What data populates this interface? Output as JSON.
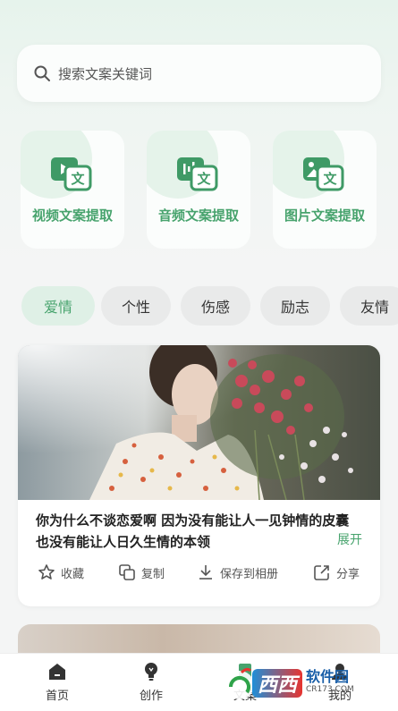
{
  "search": {
    "placeholder": "搜索文案关键词"
  },
  "tools": [
    {
      "label": "视频文案提取",
      "icon": "video-to-text-icon"
    },
    {
      "label": "音频文案提取",
      "icon": "audio-to-text-icon"
    },
    {
      "label": "图片文案提取",
      "icon": "image-to-text-icon"
    }
  ],
  "tool_icon_char": "文",
  "categories": [
    {
      "label": "爱情",
      "active": true
    },
    {
      "label": "个性",
      "active": false
    },
    {
      "label": "伤感",
      "active": false
    },
    {
      "label": "励志",
      "active": false
    },
    {
      "label": "友情",
      "active": false
    }
  ],
  "card": {
    "text": "你为什么不谈恋爱啊 因为没有能让人一见钟情的皮囊 也没有能让人日久生情的本领",
    "expand_label": "展开",
    "actions": [
      {
        "label": "收藏",
        "icon": "star-icon"
      },
      {
        "label": "复制",
        "icon": "copy-icon"
      },
      {
        "label": "保存到相册",
        "icon": "download-icon"
      },
      {
        "label": "分享",
        "icon": "share-icon"
      }
    ]
  },
  "tabbar": [
    {
      "label": "首页",
      "icon": "home-icon"
    },
    {
      "label": "创作",
      "icon": "lightbulb-icon"
    },
    {
      "label": "文案",
      "icon": "document-icon"
    },
    {
      "label": "我的",
      "icon": "user-icon"
    }
  ],
  "watermark": {
    "brand": "西西",
    "site": "软件园",
    "domain": "CR173.COM"
  },
  "colors": {
    "accent": "#47a36d",
    "accent_light": "#dff0e6",
    "icon_green": "#3f9a66"
  }
}
